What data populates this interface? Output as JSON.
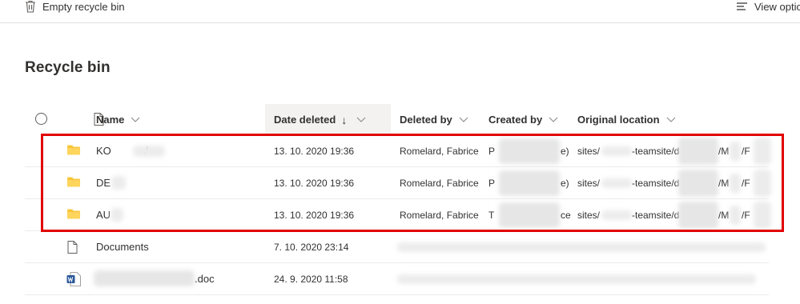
{
  "toolbar": {
    "empty_label": "Empty recycle bin",
    "view_label": "View optio"
  },
  "page": {
    "title": "Recycle bin"
  },
  "columns": {
    "name": "Name",
    "date_deleted": "Date deleted",
    "sort_arrow": "↓",
    "deleted_by": "Deleted by",
    "created_by": "Created by",
    "original_location": "Original location"
  },
  "rows": [
    {
      "type": "folder",
      "name": "KO",
      "name_tail": "/",
      "date": "13. 10. 2020 19:36",
      "deleted_by": "Romelard, Fabrice",
      "created_by_start": "P",
      "created_by_end": "e)",
      "location_start": "sites/",
      "location_mid": "-teamsite/d",
      "location_end": "/M",
      "location_tail": "/F"
    },
    {
      "type": "folder",
      "name": "DE",
      "name_tail": "",
      "date": "13. 10. 2020 19:36",
      "deleted_by": "Romelard, Fabrice",
      "created_by_start": "P",
      "created_by_end": "e)",
      "location_start": "sites/",
      "location_mid": "-teamsite/d",
      "location_end": "/M",
      "location_tail": "/F"
    },
    {
      "type": "folder",
      "name": "AU",
      "name_tail": "",
      "date": "13. 10. 2020 19:36",
      "deleted_by": "Romelard, Fabrice",
      "created_by_start": "T",
      "created_by_end": "ce",
      "location_start": "sites/",
      "location_mid": "-teamsite/d",
      "location_end": "/M",
      "location_tail": "/F"
    },
    {
      "type": "file",
      "name": "Documents",
      "name_tail": "",
      "date": "7. 10. 2020 23:14"
    },
    {
      "type": "word",
      "name": "",
      "name_tail": ".doc",
      "date": "24. 9. 2020 11:58"
    }
  ],
  "colors": {
    "folder": "#f8c63d",
    "highlight": "#e10000",
    "word": "#2b579a"
  }
}
